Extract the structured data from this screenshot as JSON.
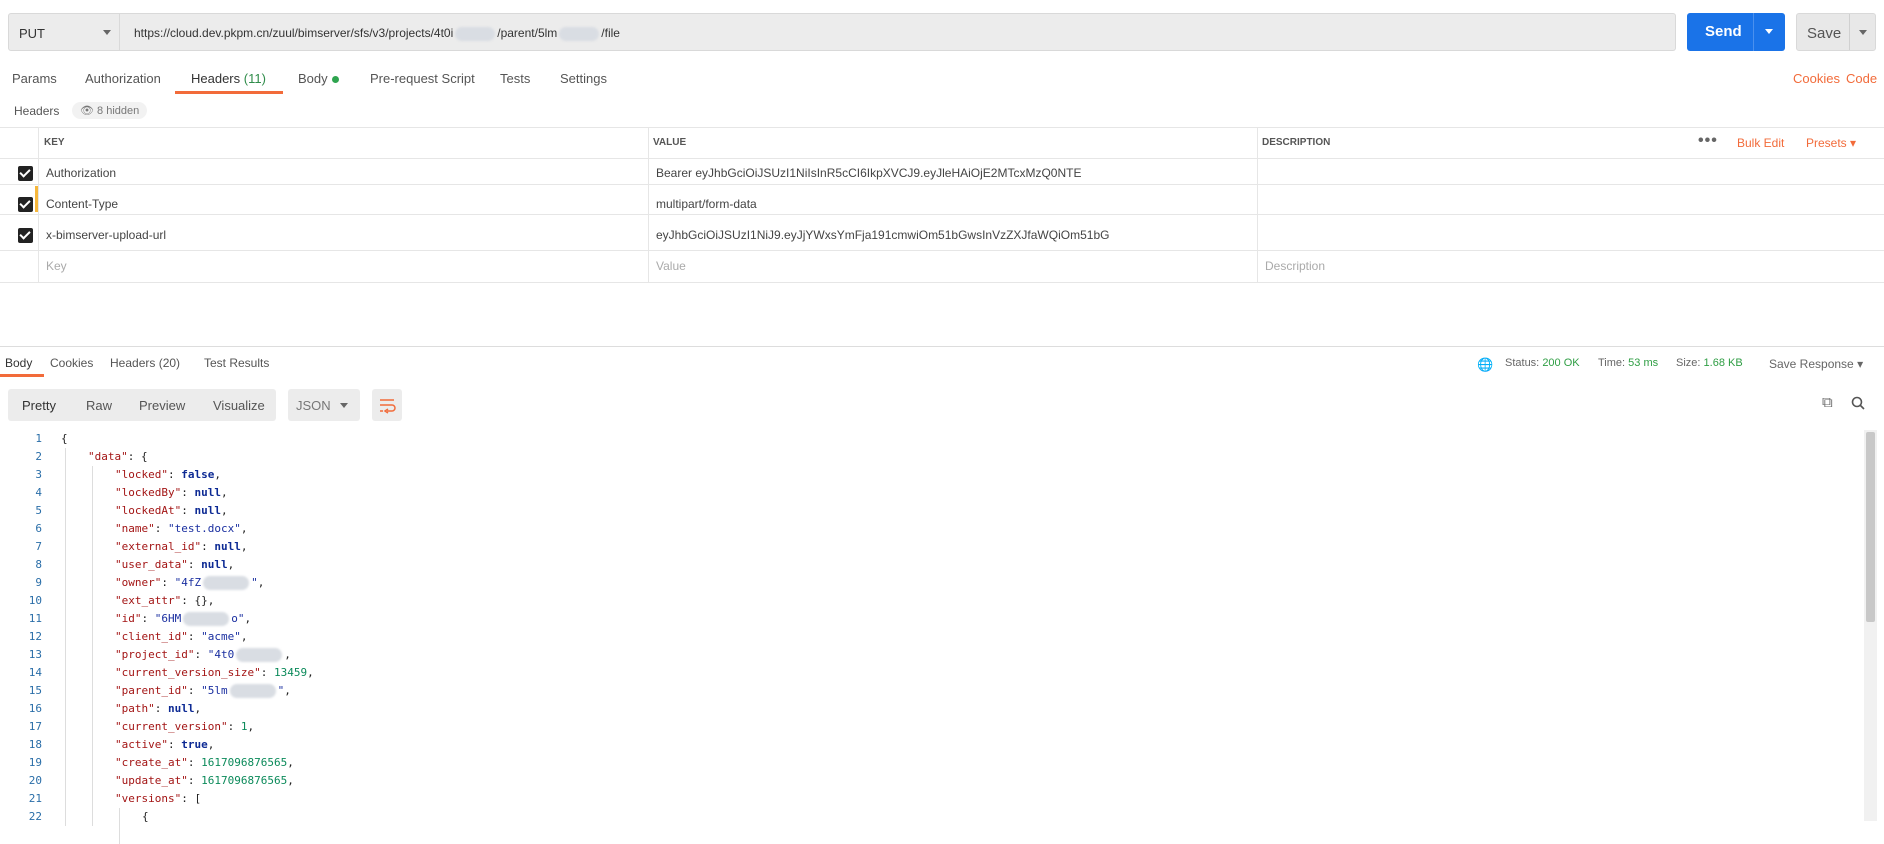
{
  "request": {
    "method": "PUT",
    "url_parts": [
      "https://cloud.dev.pkpm.cn/zuul/bimserver/sfs/v3/projects/4t0i",
      "/parent/5lm",
      "/file"
    ],
    "send_label": "Send",
    "save_label": "Save"
  },
  "tabs": {
    "params": "Params",
    "authorization": "Authorization",
    "headers": "Headers",
    "headers_count": "(11)",
    "body": "Body",
    "prerequest": "Pre-request Script",
    "tests": "Tests",
    "settings": "Settings",
    "cookies": "Cookies",
    "code": "Code"
  },
  "headers_section": {
    "label": "Headers",
    "hidden": "8 hidden",
    "col_key": "KEY",
    "col_value": "VALUE",
    "col_desc": "DESCRIPTION",
    "bulk_edit": "Bulk Edit",
    "presets": "Presets",
    "rows": [
      {
        "key": "Authorization",
        "value": "Bearer eyJhbGciOiJSUzI1NiIsInR5cCI6IkpXVCJ9.eyJleHAiOjE2MTcxMzQ0NTE"
      },
      {
        "key": "Content-Type",
        "value": "multipart/form-data"
      },
      {
        "key": "x-bimserver-upload-url",
        "value": "eyJhbGciOiJSUzI1NiJ9.eyJjYWxsYmFja191cmwiOm51bGwsInVzZXJfaWQiOm51bG"
      }
    ],
    "placeholder_key": "Key",
    "placeholder_value": "Value",
    "placeholder_desc": "Description"
  },
  "response": {
    "tabs": [
      "Body",
      "Cookies",
      "Headers (20)",
      "Test Results"
    ],
    "status_label": "Status:",
    "status_value": "200 OK",
    "time_label": "Time:",
    "time_value": "53 ms",
    "size_label": "Size:",
    "size_value": "1.68 KB",
    "save_response": "Save Response",
    "views": [
      "Pretty",
      "Raw",
      "Preview",
      "Visualize"
    ],
    "format": "JSON"
  },
  "code_lines": [
    {
      "n": "1",
      "indent": 0,
      "t": [
        [
          "p",
          "{"
        ]
      ]
    },
    {
      "n": "2",
      "indent": 1,
      "t": [
        [
          "k",
          "\"data\""
        ],
        [
          "p",
          ": {"
        ]
      ]
    },
    {
      "n": "3",
      "indent": 2,
      "t": [
        [
          "k",
          "\"locked\""
        ],
        [
          "p",
          ": "
        ],
        [
          "b",
          "false"
        ],
        [
          "p",
          ","
        ]
      ]
    },
    {
      "n": "4",
      "indent": 2,
      "t": [
        [
          "k",
          "\"lockedBy\""
        ],
        [
          "p",
          ": "
        ],
        [
          "b",
          "null"
        ],
        [
          "p",
          ","
        ]
      ]
    },
    {
      "n": "5",
      "indent": 2,
      "t": [
        [
          "k",
          "\"lockedAt\""
        ],
        [
          "p",
          ": "
        ],
        [
          "b",
          "null"
        ],
        [
          "p",
          ","
        ]
      ]
    },
    {
      "n": "6",
      "indent": 2,
      "t": [
        [
          "k",
          "\"name\""
        ],
        [
          "p",
          ": "
        ],
        [
          "s",
          "\"test.docx\""
        ],
        [
          "p",
          ","
        ]
      ]
    },
    {
      "n": "7",
      "indent": 2,
      "t": [
        [
          "k",
          "\"external_id\""
        ],
        [
          "p",
          ": "
        ],
        [
          "b",
          "null"
        ],
        [
          "p",
          ","
        ]
      ]
    },
    {
      "n": "8",
      "indent": 2,
      "t": [
        [
          "k",
          "\"user_data\""
        ],
        [
          "p",
          ": "
        ],
        [
          "b",
          "null"
        ],
        [
          "p",
          ","
        ]
      ]
    },
    {
      "n": "9",
      "indent": 2,
      "t": [
        [
          "k",
          "\"owner\""
        ],
        [
          "p",
          ": "
        ],
        [
          "s",
          "\"4fZ"
        ],
        [
          "x",
          ""
        ],
        [
          "s",
          "\""
        ],
        [
          "p",
          ","
        ]
      ]
    },
    {
      "n": "10",
      "indent": 2,
      "t": [
        [
          "k",
          "\"ext_attr\""
        ],
        [
          "p",
          ": {},"
        ]
      ]
    },
    {
      "n": "11",
      "indent": 2,
      "t": [
        [
          "k",
          "\"id\""
        ],
        [
          "p",
          ": "
        ],
        [
          "s",
          "\"6HM"
        ],
        [
          "x",
          ""
        ],
        [
          "s",
          "o\""
        ],
        [
          "p",
          ","
        ]
      ]
    },
    {
      "n": "12",
      "indent": 2,
      "t": [
        [
          "k",
          "\"client_id\""
        ],
        [
          "p",
          ": "
        ],
        [
          "s",
          "\"acme\""
        ],
        [
          "p",
          ","
        ]
      ]
    },
    {
      "n": "13",
      "indent": 2,
      "t": [
        [
          "k",
          "\"project_id\""
        ],
        [
          "p",
          ": "
        ],
        [
          "s",
          "\"4t0"
        ],
        [
          "x",
          ""
        ],
        [
          "p",
          ","
        ]
      ]
    },
    {
      "n": "14",
      "indent": 2,
      "t": [
        [
          "k",
          "\"current_version_size\""
        ],
        [
          "p",
          ": "
        ],
        [
          "n",
          "13459"
        ],
        [
          "p",
          ","
        ]
      ]
    },
    {
      "n": "15",
      "indent": 2,
      "t": [
        [
          "k",
          "\"parent_id\""
        ],
        [
          "p",
          ": "
        ],
        [
          "s",
          "\"5lm"
        ],
        [
          "x",
          ""
        ],
        [
          "s",
          "\""
        ],
        [
          "p",
          ","
        ]
      ]
    },
    {
      "n": "16",
      "indent": 2,
      "t": [
        [
          "k",
          "\"path\""
        ],
        [
          "p",
          ": "
        ],
        [
          "b",
          "null"
        ],
        [
          "p",
          ","
        ]
      ]
    },
    {
      "n": "17",
      "indent": 2,
      "t": [
        [
          "k",
          "\"current_version\""
        ],
        [
          "p",
          ": "
        ],
        [
          "n",
          "1"
        ],
        [
          "p",
          ","
        ]
      ]
    },
    {
      "n": "18",
      "indent": 2,
      "t": [
        [
          "k",
          "\"active\""
        ],
        [
          "p",
          ": "
        ],
        [
          "b",
          "true"
        ],
        [
          "p",
          ","
        ]
      ]
    },
    {
      "n": "19",
      "indent": 2,
      "t": [
        [
          "k",
          "\"create_at\""
        ],
        [
          "p",
          ": "
        ],
        [
          "n",
          "1617096876565"
        ],
        [
          "p",
          ","
        ]
      ]
    },
    {
      "n": "20",
      "indent": 2,
      "t": [
        [
          "k",
          "\"update_at\""
        ],
        [
          "p",
          ": "
        ],
        [
          "n",
          "1617096876565"
        ],
        [
          "p",
          ","
        ]
      ]
    },
    {
      "n": "21",
      "indent": 2,
      "t": [
        [
          "k",
          "\"versions\""
        ],
        [
          "p",
          ": ["
        ]
      ]
    },
    {
      "n": "22",
      "indent": 3,
      "t": [
        [
          "p",
          "{"
        ]
      ]
    }
  ]
}
